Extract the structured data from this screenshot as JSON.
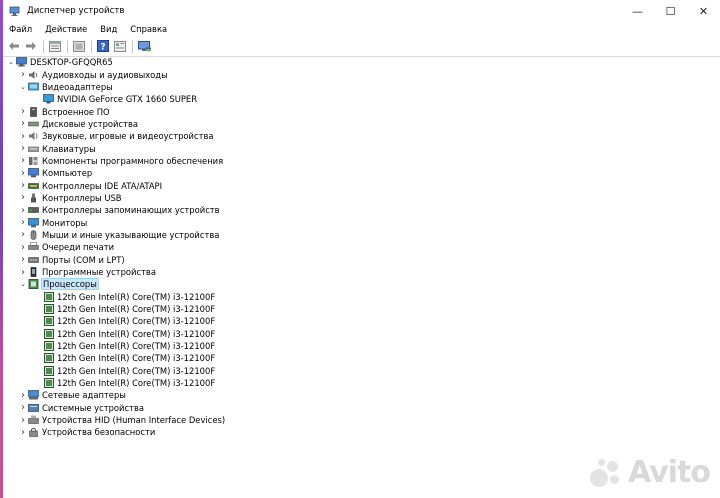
{
  "window": {
    "title": "Диспетчер устройств",
    "minimize": "—",
    "maximize": "☐",
    "close": "✕"
  },
  "menu": {
    "file": "Файл",
    "action": "Действие",
    "view": "Вид",
    "help": "Справка"
  },
  "tree": {
    "root": "DESKTOP-GFQQR65",
    "categories": [
      {
        "label": "Аудиовходы и аудиовыходы",
        "expanded": false
      },
      {
        "label": "Видеоадаптеры",
        "expanded": true,
        "children": [
          "NVIDIA GeForce GTX 1660 SUPER"
        ]
      },
      {
        "label": "Встроенное ПО",
        "expanded": false
      },
      {
        "label": "Дисковые устройства",
        "expanded": false
      },
      {
        "label": "Звуковые, игровые и видеоустройства",
        "expanded": false
      },
      {
        "label": "Клавиатуры",
        "expanded": false
      },
      {
        "label": "Компоненты программного обеспечения",
        "expanded": false
      },
      {
        "label": "Компьютер",
        "expanded": false
      },
      {
        "label": "Контроллеры IDE ATA/ATAPI",
        "expanded": false
      },
      {
        "label": "Контроллеры USB",
        "expanded": false
      },
      {
        "label": "Контроллеры запоминающих устройств",
        "expanded": false
      },
      {
        "label": "Мониторы",
        "expanded": false
      },
      {
        "label": "Мыши и иные указывающие устройства",
        "expanded": false
      },
      {
        "label": "Очереди печати",
        "expanded": false
      },
      {
        "label": "Порты (COM и LPT)",
        "expanded": false
      },
      {
        "label": "Программные устройства",
        "expanded": false
      },
      {
        "label": "Процессоры",
        "expanded": true,
        "selected": true,
        "children": [
          "12th Gen Intel(R) Core(TM) i3-12100F",
          "12th Gen Intel(R) Core(TM) i3-12100F",
          "12th Gen Intel(R) Core(TM) i3-12100F",
          "12th Gen Intel(R) Core(TM) i3-12100F",
          "12th Gen Intel(R) Core(TM) i3-12100F",
          "12th Gen Intel(R) Core(TM) i3-12100F",
          "12th Gen Intel(R) Core(TM) i3-12100F",
          "12th Gen Intel(R) Core(TM) i3-12100F"
        ]
      },
      {
        "label": "Сетевые адаптеры",
        "expanded": false
      },
      {
        "label": "Системные устройства",
        "expanded": false
      },
      {
        "label": "Устройства HID (Human Interface Devices)",
        "expanded": false
      },
      {
        "label": "Устройства безопасности",
        "expanded": false
      }
    ]
  },
  "watermark": {
    "text": "Avito"
  }
}
